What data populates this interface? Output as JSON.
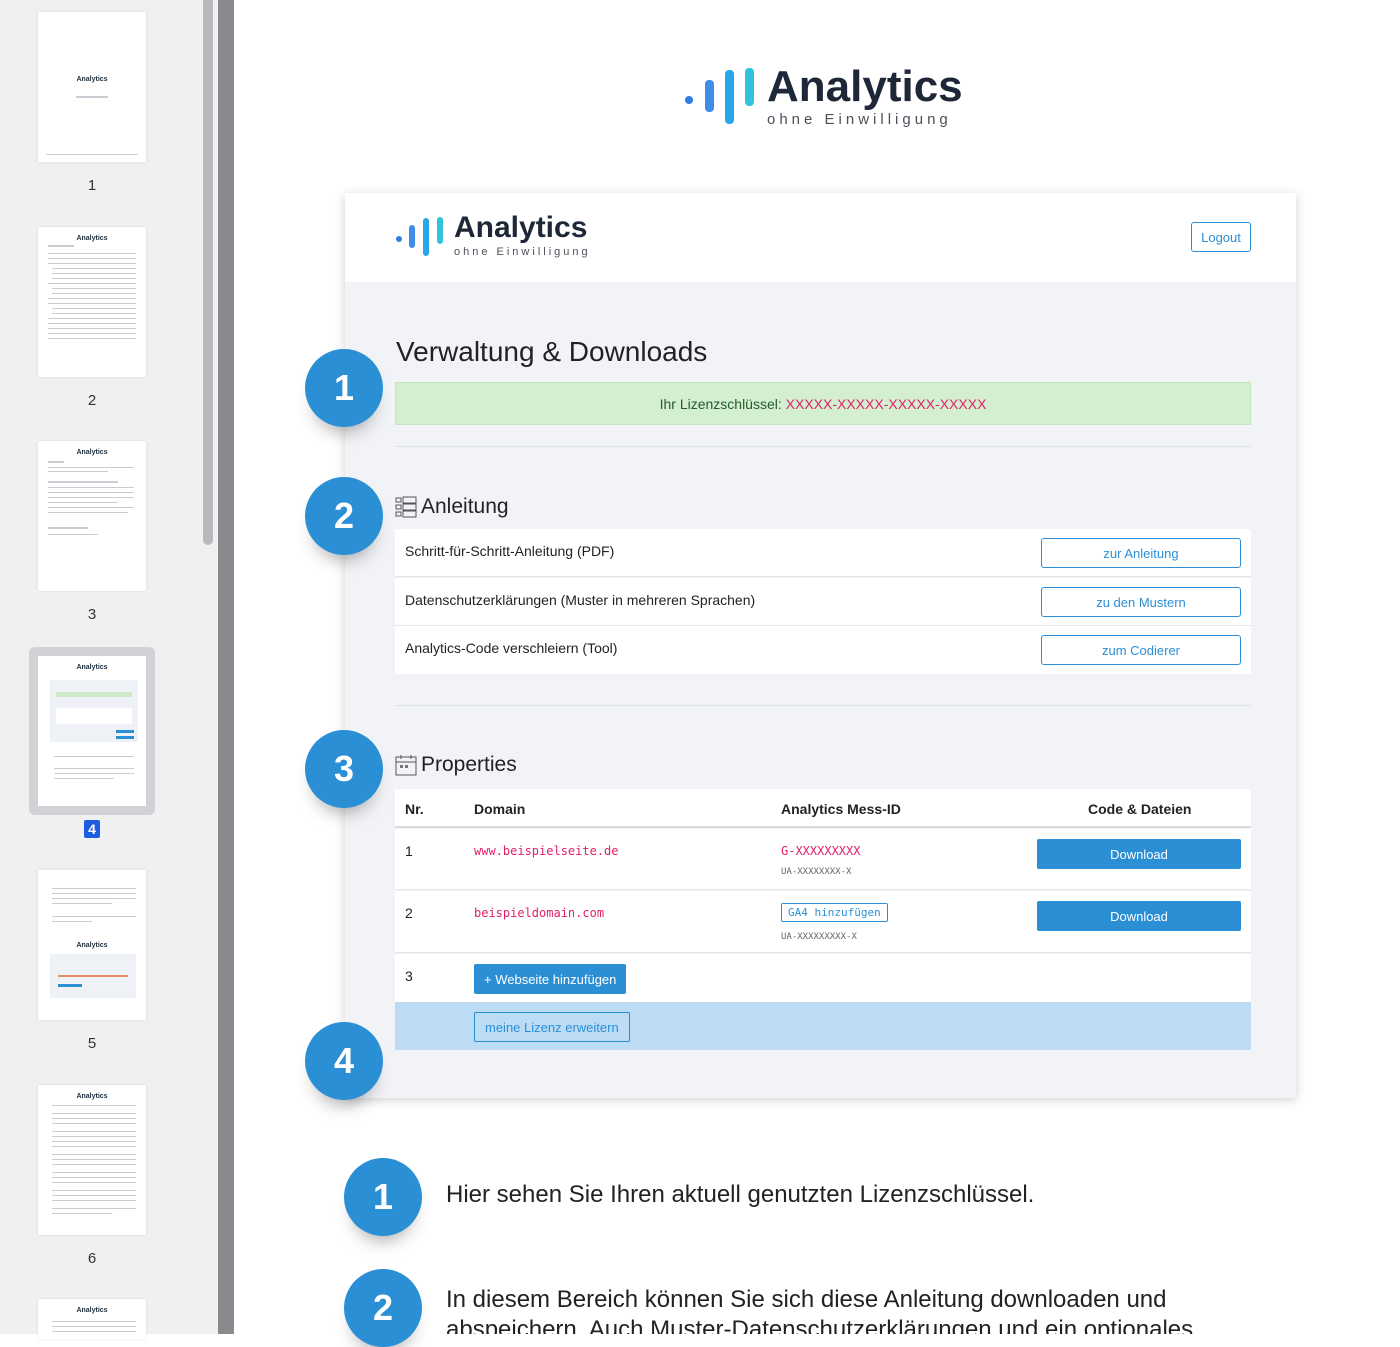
{
  "sidebar": {
    "pages": [
      {
        "number": "1",
        "logo": "Analytics"
      },
      {
        "number": "2",
        "logo": "Analytics"
      },
      {
        "number": "3",
        "logo": "Analytics"
      },
      {
        "number": "4",
        "logo": "Analytics"
      },
      {
        "number": "5",
        "logo": "Analytics"
      },
      {
        "number": "6",
        "logo": "Analytics"
      },
      {
        "number": "",
        "logo": "Analytics"
      }
    ],
    "selected_page": "4"
  },
  "document": {
    "logo_title": "Analytics",
    "logo_subtitle": "ohne Einwilligung",
    "app": {
      "logo_title": "Analytics",
      "logo_subtitle": "ohne Einwilligung",
      "logout_label": "Logout",
      "heading": "Verwaltung & Downloads",
      "license_label": "Ihr Lizenzschlüssel:",
      "license_key": "XXXXX-XXXXX-XXXXX-XXXXX",
      "anleitung": {
        "title": "Anleitung",
        "rows": [
          {
            "label": "Schritt-für-Schritt-Anleitung (PDF)",
            "button": "zur Anleitung"
          },
          {
            "label": "Datenschutzerklärungen (Muster in mehreren Sprachen)",
            "button": "zu den Mustern"
          },
          {
            "label": "Analytics-Code verschleiern (Tool)",
            "button": "zum Codierer"
          }
        ]
      },
      "properties": {
        "title": "Properties",
        "columns": [
          "Nr.",
          "Domain",
          "Analytics Mess-ID",
          "Code & Dateien"
        ],
        "rows": [
          {
            "nr": "1",
            "domain": "www.beispielseite.de",
            "mess_id": "G-XXXXXXXXX",
            "ua": "UA-XXXXXXXX-X",
            "action": "Download"
          },
          {
            "nr": "2",
            "domain": "beispieldomain.com",
            "ga4": "GA4 hinzufügen",
            "ua": "UA-XXXXXXXXX-X",
            "action": "Download"
          }
        ],
        "add_row_nr": "3",
        "add_button": "+ Webseite hinzufügen",
        "extend_button": "meine Lizenz erweitern"
      }
    },
    "markers": [
      "1",
      "2",
      "3",
      "4"
    ],
    "explanations": [
      {
        "number": "1",
        "text": "Hier sehen Sie Ihren aktuell genutzten Lizenzschlüssel."
      },
      {
        "number": "2",
        "text": "In diesem Bereich können Sie sich diese Anleitung downloaden und abspeichern. Auch Muster-Datenschutzerklärungen und ein optionales"
      }
    ]
  },
  "colors": {
    "accent": "#2b8fd6",
    "key_pink": "#e0206a",
    "license_bg": "#d4efcf",
    "selected_page": "#1d5ee0"
  },
  "icons": [
    "analytics-logo-icon",
    "list-icon",
    "calendar-icon"
  ]
}
